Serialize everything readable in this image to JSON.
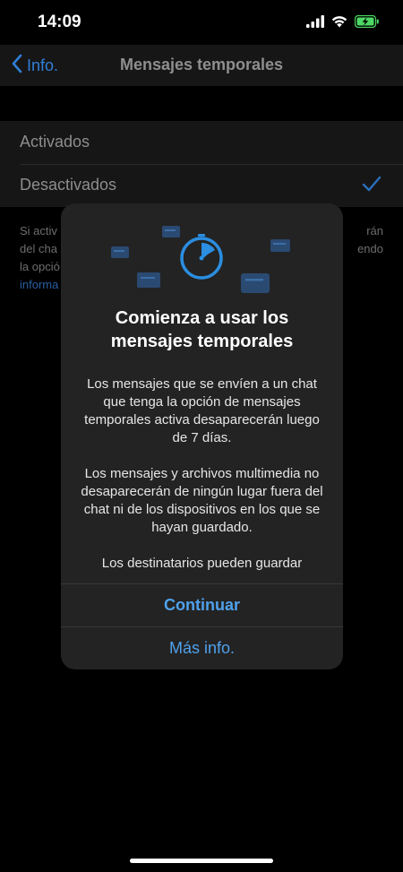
{
  "status_bar": {
    "time": "14:09"
  },
  "nav": {
    "back_label": "Info.",
    "title": "Mensajes temporales"
  },
  "options": [
    {
      "label": "Activados",
      "selected": false
    },
    {
      "label": "Desactivados",
      "selected": true
    }
  ],
  "footnote": {
    "line1_left": "Si activ",
    "line1_right": "rán",
    "line2_left": "del cha",
    "line2_right": "endo",
    "line3_left": "la opció",
    "line4_link": "informa"
  },
  "modal": {
    "title_line1": "Comienza a usar los",
    "title_line2": "mensajes temporales",
    "paragraph1": "Los mensajes que se envíen a un chat que tenga la opción de mensajes temporales activa desaparecerán luego de 7 días.",
    "paragraph2": "Los mensajes y archivos multimedia no desaparecerán de ningún lugar fuera del chat ni de los dispositivos en los que se hayan guardado.",
    "paragraph3": "Los destinatarios pueden guardar",
    "primary_button": "Continuar",
    "secondary_button": "Más info."
  },
  "colors": {
    "accent": "#4fa1ec",
    "timer_blue": "#2b8ee0",
    "modal_bg": "#232323"
  },
  "icons": {
    "back": "chevron-left-icon",
    "check": "checkmark-icon",
    "timer": "timer-icon",
    "signal": "cellular-signal-icon",
    "wifi": "wifi-icon",
    "battery": "battery-charging-icon"
  }
}
